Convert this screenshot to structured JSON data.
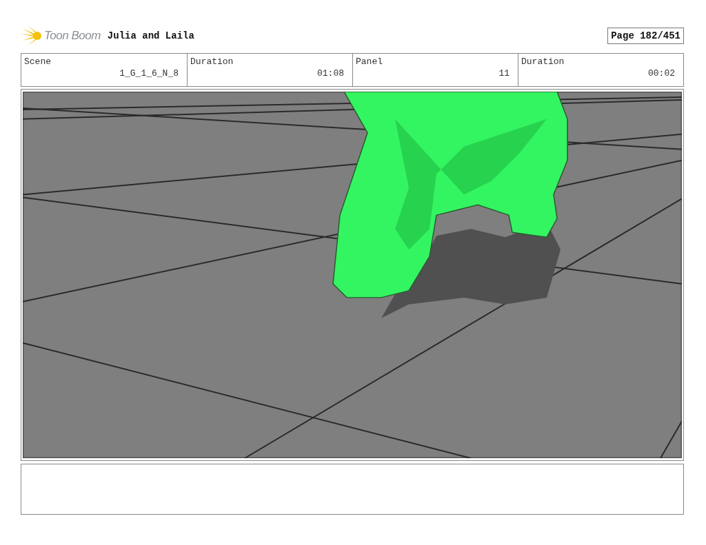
{
  "header": {
    "logo": "Toon Boom",
    "title": "Julia and Laila",
    "page": "Page 182/451"
  },
  "fields": [
    {
      "label": "Scene",
      "value": "1_G_1_6_N_8"
    },
    {
      "label": "Duration",
      "value": "01:08"
    },
    {
      "label": "Panel",
      "value": "11"
    },
    {
      "label": "Duration",
      "value": "00:02"
    }
  ]
}
